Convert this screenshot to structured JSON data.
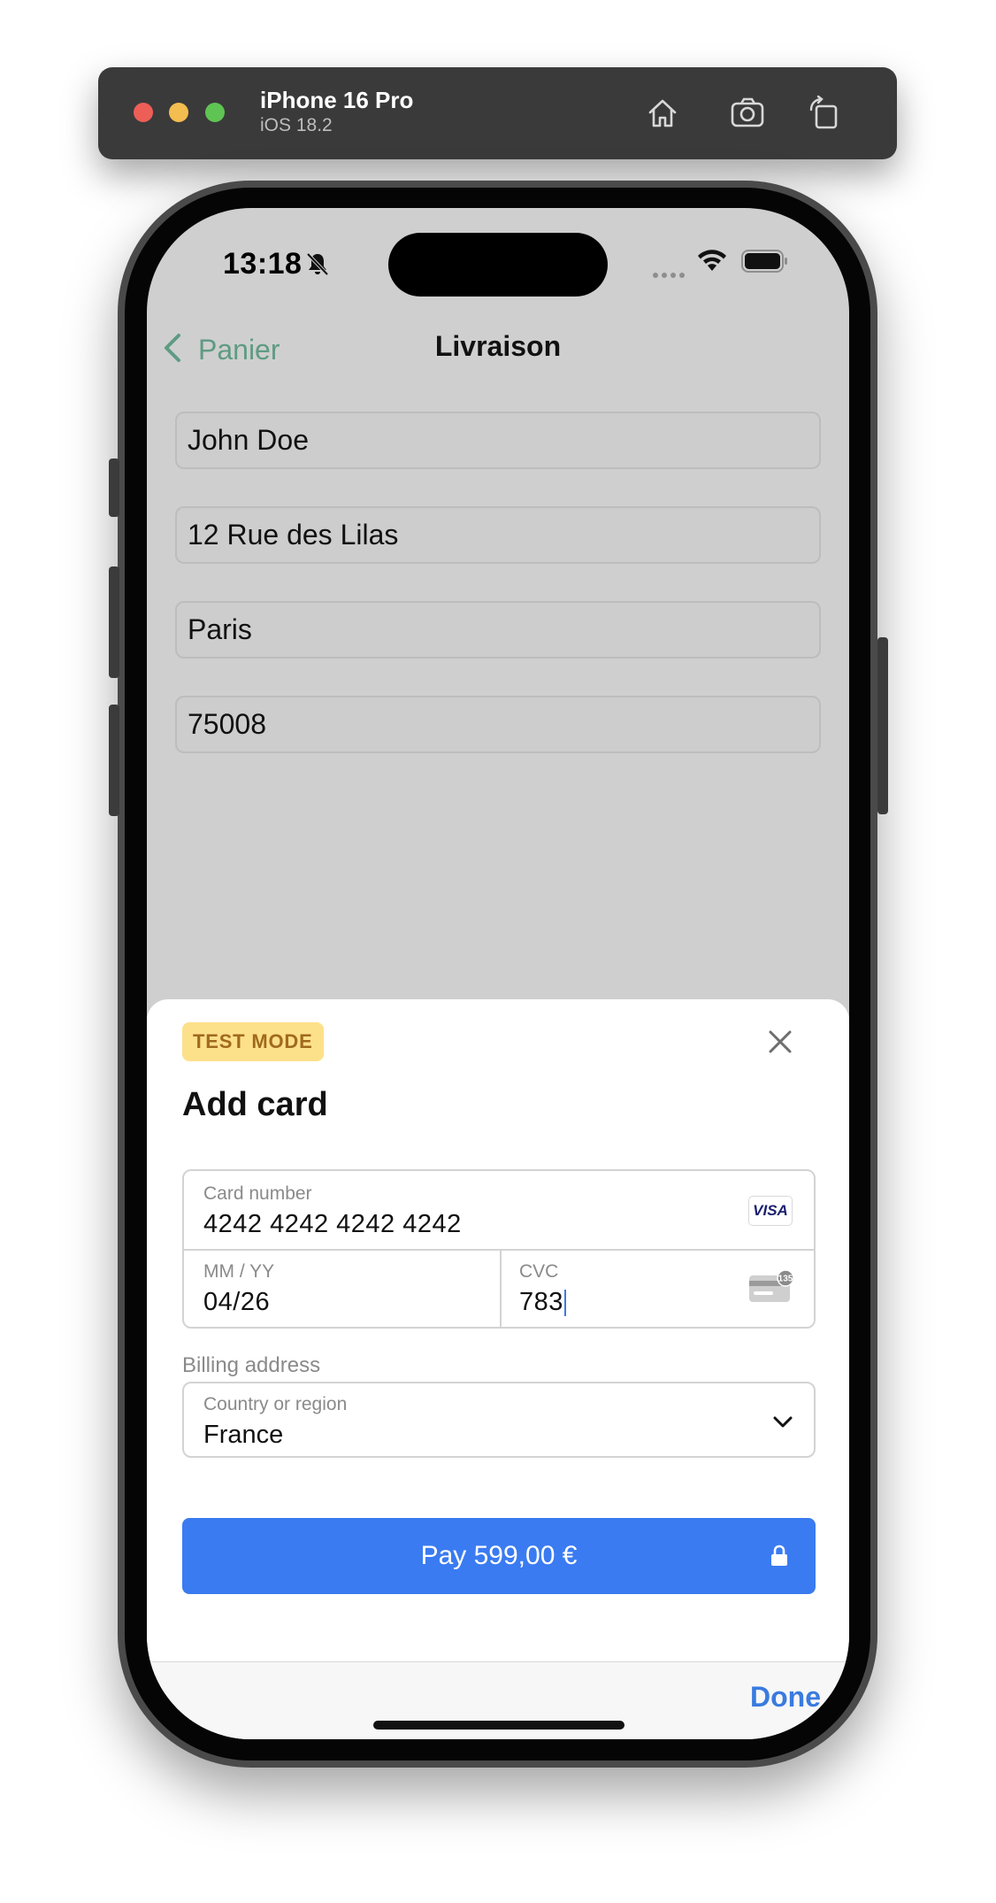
{
  "simulator": {
    "device_name": "iPhone 16 Pro",
    "os_version": "iOS 18.2",
    "tools": [
      "home-icon",
      "screenshot-icon",
      "rotate-icon"
    ]
  },
  "status_bar": {
    "time": "13:18",
    "icons": [
      "bell-slash-icon",
      "cellular-icon",
      "wifi-icon",
      "battery-icon"
    ]
  },
  "nav": {
    "back_label": "Panier",
    "title": "Livraison",
    "accent": "#5f9b84"
  },
  "form": {
    "fields": [
      {
        "value": "John Doe"
      },
      {
        "value": "12 Rue des Lilas"
      },
      {
        "value": "Paris"
      },
      {
        "value": "75008"
      }
    ]
  },
  "sheet": {
    "badge": "TEST MODE",
    "title": "Add card",
    "card_number": {
      "label": "Card number",
      "value": "4242 4242 4242 4242",
      "brand": "VISA"
    },
    "expiry": {
      "label": "MM / YY",
      "value": "04/26"
    },
    "cvc": {
      "label": "CVC",
      "value": "783",
      "icon_badge": "135"
    },
    "billing_label": "Billing address",
    "country": {
      "label": "Country or region",
      "value": "France"
    },
    "pay_button": "Pay 599,00 €",
    "pay_color": "#3a7bf1"
  },
  "keyboard_bar": {
    "done": "Done"
  }
}
